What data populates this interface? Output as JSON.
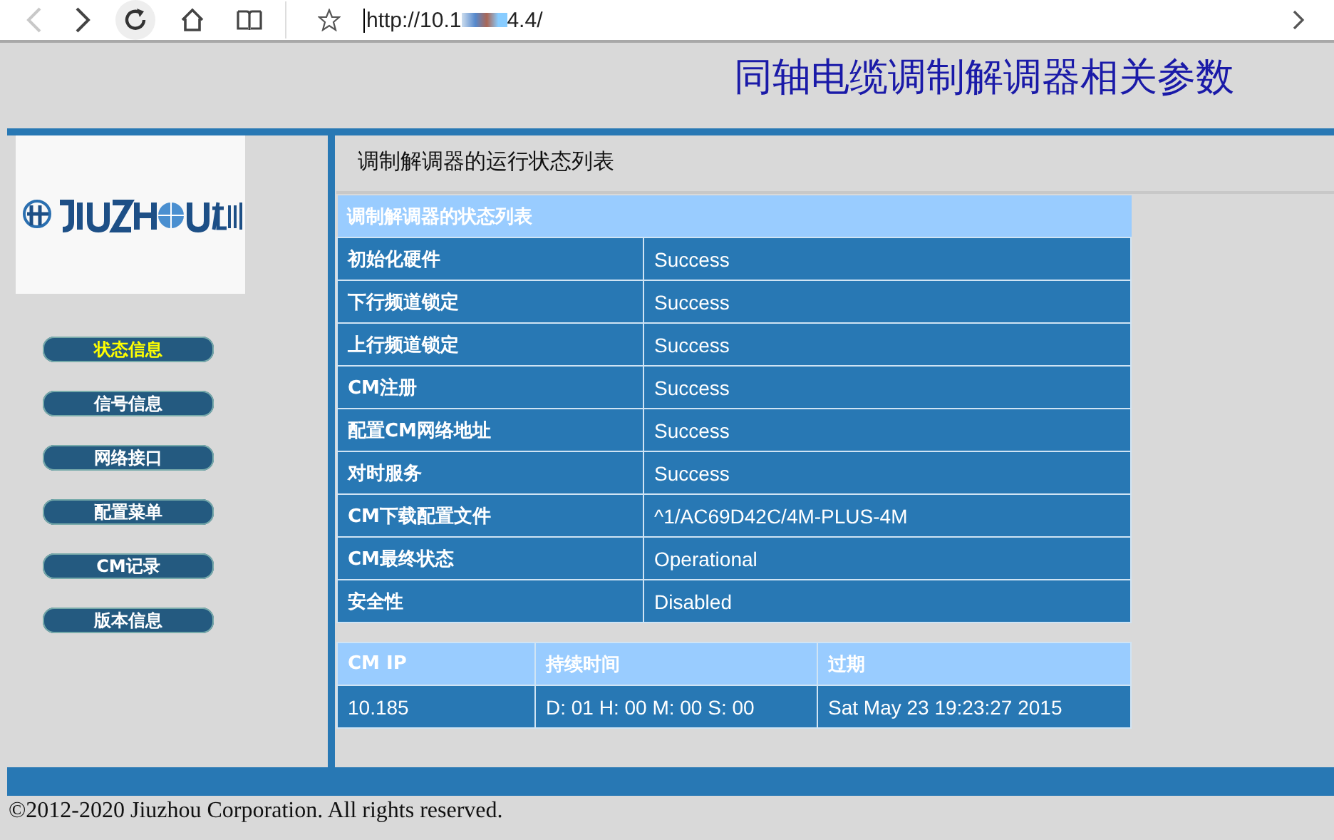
{
  "browser": {
    "url": "http://10.1",
    "url_tail": "4.4/"
  },
  "page_title": "同轴电缆调制解调器相关参数",
  "nav": [
    {
      "label": "状态信息",
      "selected": true
    },
    {
      "label": "信号信息",
      "selected": false
    },
    {
      "label": "网络接口",
      "selected": false
    },
    {
      "label": "配置菜单",
      "selected": false
    },
    {
      "label": "CM记录",
      "selected": false
    },
    {
      "label": "版本信息",
      "selected": false
    }
  ],
  "section_title": "调制解调器的运行状态列表",
  "status_table": {
    "caption": "调制解调器的状态列表",
    "rows": [
      {
        "label": "初始化硬件",
        "value": "Success"
      },
      {
        "label": "下行频道锁定",
        "value": "Success"
      },
      {
        "label": "上行频道锁定",
        "value": "Success"
      },
      {
        "label": "CM注册",
        "value": "Success"
      },
      {
        "label": "配置CM网络地址",
        "value": "Success"
      },
      {
        "label": "对时服务",
        "value": "Success"
      },
      {
        "label": "CM下载配置文件",
        "value": "^1/AC69D42C/4M-PLUS-4M"
      },
      {
        "label": "CM最终状态",
        "value": "Operational"
      },
      {
        "label": "安全性",
        "value": "Disabled"
      }
    ]
  },
  "ip_table": {
    "columns": [
      "CM IP",
      "持续时间",
      "过期"
    ],
    "rows": [
      [
        "10.185",
        "D: 01 H: 00 M: 00 S: 00",
        "Sat May 23 19:23:27 2015"
      ]
    ]
  },
  "footer": "©2012-2020 Jiuzhou Corporation. All rights reserved."
}
